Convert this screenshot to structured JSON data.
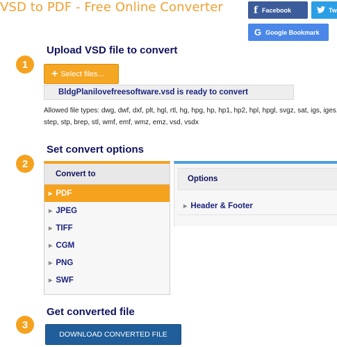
{
  "header": {
    "title": "VSD to PDF - Free Online Converter"
  },
  "social": {
    "facebook_label": "Facebook",
    "twitter_label": "Tw",
    "google_label": "Google Bookmark",
    "facebook_icon": "facebook-icon",
    "twitter_icon": "twitter-icon",
    "google_icon": "google-icon"
  },
  "step1": {
    "number": "1",
    "heading": "Upload VSD file to convert",
    "select_label": "Select files...",
    "ready_text": "BldgPlanilovefreesoftware.vsd is ready to convert",
    "allowed_text": "Allowed file types: dwg, dwf, dxf, plt, hgl, rtl, hg, hpg, hp, hp1, hp2, hpl, hpgl, svgz, sat, igs, iges, step, stp, brep, stl, wmf, emf, wmz, emz, vsd, vsdx"
  },
  "step2": {
    "number": "2",
    "heading": "Set convert options",
    "convert_to_label": "Convert to",
    "formats": [
      "PDF",
      "JPEG",
      "TIFF",
      "CGM",
      "PNG",
      "SWF"
    ],
    "selected_format": "PDF",
    "options_label": "Options",
    "header_footer_label": "Header & Footer"
  },
  "step3": {
    "number": "3",
    "heading": "Get converted file",
    "download_label": "DOWNLOAD CONVERTED FILE"
  },
  "colors": {
    "accent_orange": "#f5a21f",
    "heading_navy": "#11115e",
    "download_blue": "#1f5e9a",
    "options_blue": "#4aa0e0"
  }
}
